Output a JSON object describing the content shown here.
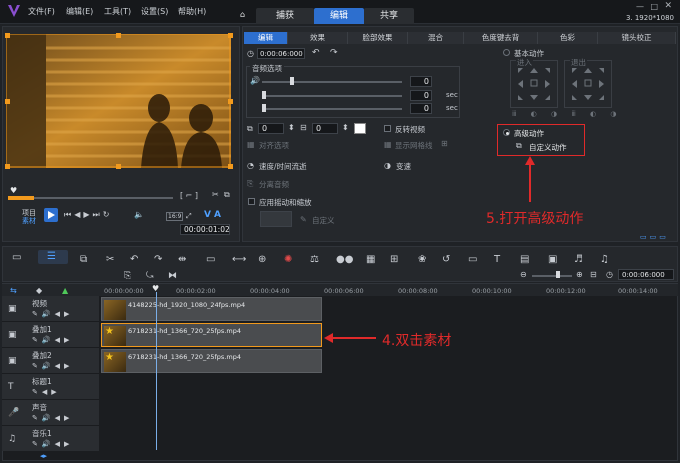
{
  "menu": [
    "文件(F)",
    "编辑(E)",
    "工具(T)",
    "设置(S)",
    "帮助(H)"
  ],
  "main_tabs": [
    "捕获",
    "编辑",
    "共享"
  ],
  "resolution": "3. 1920*1080",
  "preview": {
    "project_label": "项目",
    "clip_label": "素材",
    "timecode": "00:00:01:02",
    "v_label": "V",
    "a_label": "A"
  },
  "edit_tabs": [
    "编辑",
    "效果",
    "脸部效果",
    "混合",
    "色度键去背",
    "色彩",
    "镜头校正"
  ],
  "edit_panel": {
    "duration": "0:00:06:000",
    "audio_section": "音频选项",
    "volume_value": "0",
    "fade_in_value": "0",
    "fade_out_value": "0",
    "sec": "sec",
    "rotate_a": "0",
    "rotate_b": "0",
    "reverse_video": "反转视频",
    "align_options": "对齐选项",
    "show_grid": "显示网格线",
    "speed_time_remap": "速度/时间流逝",
    "variable_speed": "变速",
    "split_audio": "分离音频",
    "apply_pan_zoom": "应用摇动和缩放",
    "custom": "自定义",
    "basic_motion": "基本动作",
    "enter": "进入",
    "exit": "退出",
    "advanced_motion": "高级动作",
    "custom_motion": "自定义动作"
  },
  "annotations": {
    "step5": "5.打开高级动作",
    "step4": "4.双击素材"
  },
  "timeline": {
    "timecode": "0:00:06:000",
    "ruler": [
      "00:00:00:00",
      "00:00:02:00",
      "00:00:04:00",
      "00:00:06:00",
      "00:00:08:00",
      "00:00:10:00",
      "00:00:12:00",
      "00:00:14:00"
    ],
    "tracks": [
      "视频",
      "叠加1",
      "叠加2",
      "标题1",
      "声音",
      "音乐1"
    ],
    "clips": [
      {
        "name": "4148225-hd_1920_1080_24fps.mp4"
      },
      {
        "name": "6718231-hd_1366_720_25fps.mp4"
      },
      {
        "name": "6718231-hd_1366_720_25fps.mp4"
      }
    ]
  },
  "colors": {
    "accent": "#2d6fcf",
    "annotation_red": "#e02a2a",
    "frame_orange": "#f29a1d"
  }
}
